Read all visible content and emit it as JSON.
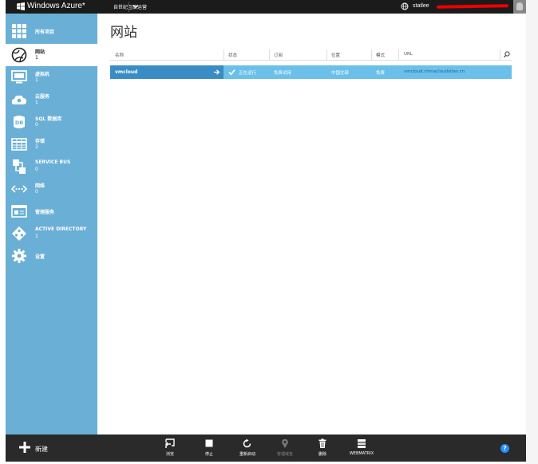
{
  "topbar": {
    "brand": "Windows Azure*",
    "subscription": "自世纪互联运营",
    "user": "statlee"
  },
  "sidebar": {
    "items": [
      {
        "label": "所有项目",
        "count": "",
        "icon": "grid-icon"
      },
      {
        "label": "网站",
        "count": "1",
        "icon": "websites-icon"
      },
      {
        "label": "虚拟机",
        "count": "1",
        "icon": "monitor-icon"
      },
      {
        "label": "云服务",
        "count": "1",
        "icon": "cloud-gear-icon"
      },
      {
        "label": "SQL 数据库",
        "count": "0",
        "icon": "database-icon"
      },
      {
        "label": "存储",
        "count": "2",
        "icon": "table-icon"
      },
      {
        "label": "SERVICE BUS",
        "count": "0",
        "icon": "service-bus-icon"
      },
      {
        "label": "网络",
        "count": "0",
        "icon": "network-icon"
      },
      {
        "label": "管理服务",
        "count": "",
        "icon": "management-icon"
      },
      {
        "label": "ACTIVE DIRECTORY",
        "count": "1",
        "icon": "directory-icon"
      },
      {
        "label": "设置",
        "count": "",
        "icon": "settings-gear-icon"
      }
    ],
    "active_index": 1
  },
  "main": {
    "title": "网站",
    "columns": [
      "名称",
      "状态",
      "订阅",
      "位置",
      "模式",
      "URL"
    ],
    "rows": [
      {
        "name": "vmcloud",
        "status": "正在运行",
        "subscription": "免费试用",
        "location": "中国北部",
        "mode": "免费",
        "url": "vmcloud.chinacloudsites.cn"
      }
    ]
  },
  "bottombar": {
    "new_label": "新建",
    "commands": [
      {
        "label": "浏览",
        "icon": "browse-icon",
        "enabled": true
      },
      {
        "label": "停止",
        "icon": "stop-icon",
        "enabled": true
      },
      {
        "label": "重新启动",
        "icon": "restart-icon",
        "enabled": true
      },
      {
        "label": "管理域名",
        "icon": "domain-icon",
        "enabled": false
      },
      {
        "label": "删除",
        "icon": "trash-icon",
        "enabled": true
      },
      {
        "label": "WEBMATRIX",
        "icon": "webmatrix-icon",
        "enabled": true
      }
    ],
    "help": "?"
  },
  "colors": {
    "sidebar": "#6aafd6",
    "row_selected": "#3a8cc4",
    "row": "#6ac0e9",
    "topbar": "#1b1b1b",
    "bottombar": "#2a2a2a"
  }
}
